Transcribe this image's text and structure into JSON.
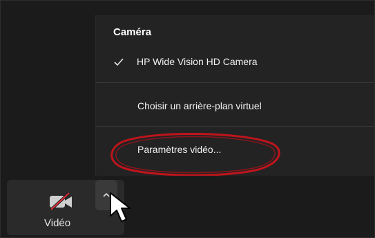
{
  "menu": {
    "heading": "Caméra",
    "camera_device": "HP Wide Vision HD Camera",
    "virtual_background": "Choisir un arrière-plan virtuel",
    "video_settings": "Paramètres vidéo..."
  },
  "toolbar": {
    "video_label": "Vidéo"
  },
  "icons": {
    "check": "checkmark-icon",
    "camera": "video-camera-off-icon",
    "caret": "chevron-up-icon",
    "cursor": "mouse-pointer-icon"
  },
  "colors": {
    "background": "#1b1b1b",
    "menu_bg": "#232323",
    "highlight_oval": "#c0141c",
    "camera_off_slash": "#e0313a"
  }
}
